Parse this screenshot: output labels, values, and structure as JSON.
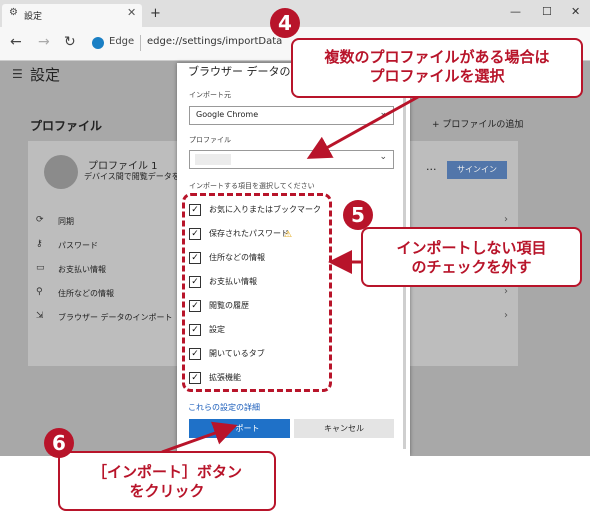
{
  "browser": {
    "tab_title": "設定",
    "tab_close": "✕",
    "new_tab": "+",
    "window_buttons": [
      "—",
      "☐",
      "✕"
    ],
    "nav": {
      "back": "←",
      "forward": "→",
      "refresh": "↻"
    },
    "edge_label": "Edge",
    "url": "edge://settings/importData"
  },
  "settings": {
    "title": "設定",
    "profile_heading": "プロファイル",
    "add_profile": "+ プロファイルの追加",
    "profile_name": "プロファイル 1",
    "profile_sub": "デバイス間で閲覧データを同",
    "more": "···",
    "signin": "サインイン",
    "menu": [
      {
        "label": "同期",
        "icon": "sync-icon",
        "glyph": "⟳"
      },
      {
        "label": "パスワード",
        "icon": "key-icon",
        "glyph": "⚷"
      },
      {
        "label": "お支払い情報",
        "icon": "card-icon",
        "glyph": "▭"
      },
      {
        "label": "住所などの情報",
        "icon": "location-icon",
        "glyph": "⚲"
      },
      {
        "label": "ブラウザー データのインポート",
        "icon": "import-icon",
        "glyph": "⇲"
      }
    ]
  },
  "dialog": {
    "title": "ブラウザー データのインポート",
    "source_label": "インポート元",
    "source_value": "Google Chrome",
    "profile_label": "プロファイル",
    "profile_value": "",
    "items_label": "インポートする項目を選択してください",
    "items": [
      {
        "label": "お気に入りまたはブックマーク",
        "checked": true
      },
      {
        "label": "保存されたパスワード",
        "checked": true
      },
      {
        "label": "住所などの情報",
        "checked": true
      },
      {
        "label": "お支払い情報",
        "checked": true
      },
      {
        "label": "閲覧の履歴",
        "checked": true
      },
      {
        "label": "設定",
        "checked": true
      },
      {
        "label": "開いているタブ",
        "checked": true
      },
      {
        "label": "拡張機能",
        "checked": true
      }
    ],
    "check_glyph": "✓",
    "warning_glyph": "⚠",
    "details_link": "これらの設定の詳細",
    "import_button": "インポート",
    "cancel_button": "キャンセル"
  },
  "annotations": [
    {
      "number": "4",
      "lines": [
        "複数のプロファイルがある場合は",
        "プロファイルを選択"
      ]
    },
    {
      "number": "5",
      "lines": [
        "インポートしない項目",
        "のチェックを外す"
      ]
    },
    {
      "number": "6",
      "lines": [
        "［インポート］ボタン",
        "をクリック"
      ]
    }
  ],
  "colors": {
    "accent": "#b8142a",
    "import_blue": "#1f71c8"
  }
}
